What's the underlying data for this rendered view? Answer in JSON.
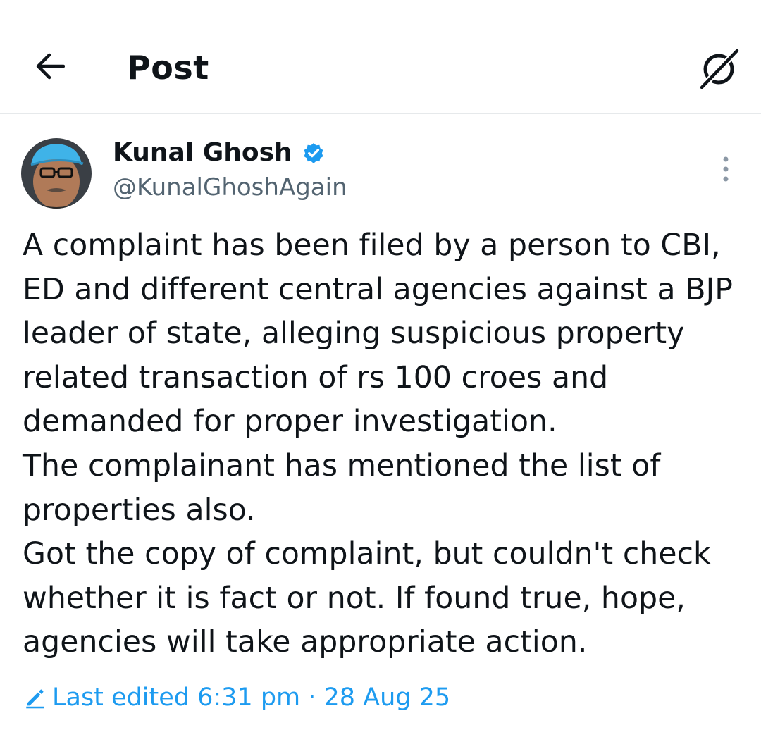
{
  "header": {
    "title": "Post",
    "back_icon": "arrow-left-icon",
    "grok_icon": "grok-icon"
  },
  "author": {
    "display_name": "Kunal Ghosh",
    "handle": "@KunalGhoshAgain",
    "verified": true,
    "verified_color": "#1d9bf0"
  },
  "post": {
    "text": "A complaint has been filed by a person to CBI, ED and different central agencies against a BJP leader of state, alleging suspicious property related transaction of rs 100 croes and demanded for proper investigation.\nThe complainant has mentioned the list of properties also.\nGot the copy of complaint, but couldn't check whether it is fact or not. If found true, hope, agencies will take appropriate action.",
    "edited_label": "Last edited 6:31 pm · 28 Aug 25",
    "edited_icon": "pencil-icon"
  },
  "colors": {
    "accent": "#1d9bf0",
    "secondary_text": "#536471",
    "divider": "#e6e9eb"
  }
}
